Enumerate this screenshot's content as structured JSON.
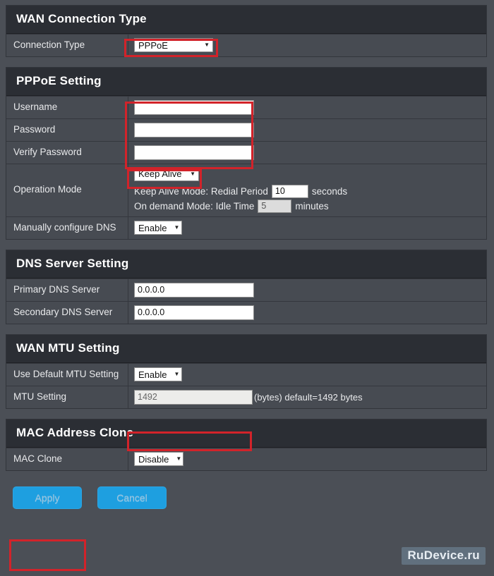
{
  "sections": {
    "wan_connection": {
      "title": "WAN Connection Type",
      "rows": [
        {
          "label": "Connection Type",
          "value": "PPPoE"
        }
      ]
    },
    "pppoe": {
      "title": "PPPoE Setting",
      "username_label": "Username",
      "username_value": "",
      "password_label": "Password",
      "password_value": "",
      "verify_password_label": "Verify Password",
      "verify_password_value": "",
      "operation_mode_label": "Operation Mode",
      "operation_mode_value": "Keep Alive",
      "keep_alive_prefix": "Keep Alive Mode: Redial Period",
      "redial_period_value": "10",
      "keep_alive_suffix": "seconds",
      "on_demand_prefix": "On demand Mode: Idle Time",
      "idle_time_value": "5",
      "on_demand_suffix": "minutes",
      "manual_dns_label": "Manually configure DNS",
      "manual_dns_value": "Enable"
    },
    "dns": {
      "title": "DNS Server Setting",
      "primary_label": "Primary DNS Server",
      "primary_value": "0.0.0.0",
      "secondary_label": "Secondary DNS Server",
      "secondary_value": "0.0.0.0"
    },
    "mtu": {
      "title": "WAN MTU Setting",
      "use_default_label": "Use Default MTU Setting",
      "use_default_value": "Enable",
      "mtu_setting_label": "MTU Setting",
      "mtu_setting_value": "1492",
      "mtu_note": "(bytes) default=1492 bytes"
    },
    "mac": {
      "title": "MAC Address Clone",
      "mac_clone_label": "MAC Clone",
      "mac_clone_value": "Disable"
    }
  },
  "buttons": {
    "apply": "Apply",
    "cancel": "Cancel"
  },
  "watermark": "RuDevice.ru",
  "icons": {
    "dropdown_caret": "▼"
  },
  "colors": {
    "page_background": "#4b4f56",
    "panel_background": "#474b52",
    "section_header": "#2b2e34",
    "highlight_red": "#d2232a",
    "button_blue": "#1e9fe0",
    "text_light": "#e9eaec"
  }
}
